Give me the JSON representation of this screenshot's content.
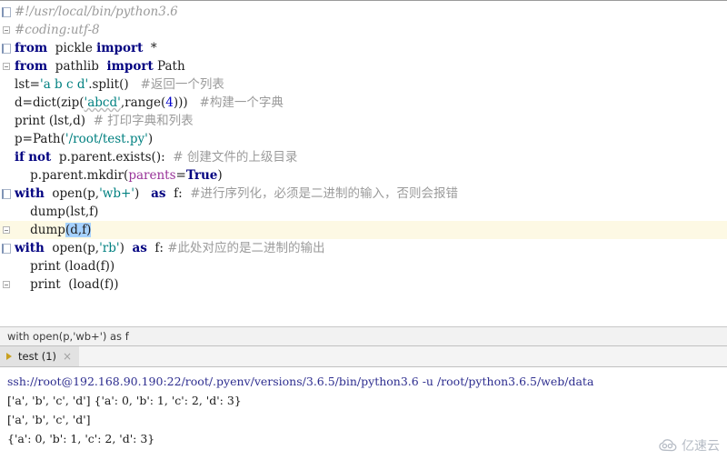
{
  "editor": {
    "lines": [
      {
        "gutter": "region",
        "highlight": false,
        "tokens": [
          {
            "t": "#!/usr/local/bin/python3.6",
            "c": "cmt-it"
          }
        ]
      },
      {
        "gutter": "collapsed",
        "highlight": false,
        "tokens": [
          {
            "t": "#coding:utf-8",
            "c": "cmt-it"
          }
        ]
      },
      {
        "gutter": "region",
        "highlight": false,
        "tokens": [
          {
            "t": "from",
            "c": "kw"
          },
          {
            "t": "  pickle ",
            "c": "plain"
          },
          {
            "t": "import",
            "c": "kw"
          },
          {
            "t": "  *",
            "c": "plain"
          }
        ]
      },
      {
        "gutter": "collapsed",
        "highlight": false,
        "tokens": [
          {
            "t": "from",
            "c": "kw"
          },
          {
            "t": "  pathlib  ",
            "c": "plain"
          },
          {
            "t": "import",
            "c": "kw"
          },
          {
            "t": " Path",
            "c": "plain"
          }
        ]
      },
      {
        "gutter": "empty",
        "highlight": false,
        "tokens": [
          {
            "t": "lst=",
            "c": "plain"
          },
          {
            "t": "'a b c d'",
            "c": "str"
          },
          {
            "t": ".split()   ",
            "c": "plain"
          },
          {
            "t": "#返回一个列表",
            "c": "cmt"
          }
        ]
      },
      {
        "gutter": "empty",
        "highlight": false,
        "tokens": [
          {
            "t": "d=dict(zip(",
            "c": "plain"
          },
          {
            "t": "'abcd'",
            "c": "str wavy"
          },
          {
            "t": ",range(",
            "c": "plain"
          },
          {
            "t": "4",
            "c": "num"
          },
          {
            "t": ")))   ",
            "c": "plain"
          },
          {
            "t": "#构建一个字典",
            "c": "cmt"
          }
        ]
      },
      {
        "gutter": "empty",
        "highlight": false,
        "tokens": [
          {
            "t": "print",
            "c": "plain"
          },
          {
            "t": " (lst,d)  ",
            "c": "plain"
          },
          {
            "t": "# 打印字典和列表",
            "c": "cmt"
          }
        ]
      },
      {
        "gutter": "empty",
        "highlight": false,
        "tokens": [
          {
            "t": "p=Path(",
            "c": "plain"
          },
          {
            "t": "'/root/test.py'",
            "c": "str"
          },
          {
            "t": ")",
            "c": "plain"
          }
        ]
      },
      {
        "gutter": "empty",
        "highlight": false,
        "tokens": [
          {
            "t": "if",
            "c": "kw"
          },
          {
            "t": " ",
            "c": "plain"
          },
          {
            "t": "not",
            "c": "kw"
          },
          {
            "t": "  p.parent.exists():  ",
            "c": "plain"
          },
          {
            "t": "# 创建文件的上级目录",
            "c": "cmt"
          }
        ]
      },
      {
        "gutter": "empty",
        "highlight": false,
        "tokens": [
          {
            "t": "    p.parent.mkdir(",
            "c": "plain"
          },
          {
            "t": "parents",
            "c": "arg"
          },
          {
            "t": "=",
            "c": "plain"
          },
          {
            "t": "True",
            "c": "kw"
          },
          {
            "t": ")",
            "c": "plain"
          }
        ]
      },
      {
        "gutter": "region",
        "highlight": false,
        "tokens": [
          {
            "t": "with",
            "c": "kw"
          },
          {
            "t": "  open(p,",
            "c": "plain"
          },
          {
            "t": "'wb+'",
            "c": "str"
          },
          {
            "t": ")   ",
            "c": "plain"
          },
          {
            "t": "as",
            "c": "kw"
          },
          {
            "t": "  f:  ",
            "c": "plain"
          },
          {
            "t": "#进行序列化，必须是二进制的输入，否则会报错",
            "c": "cmt"
          }
        ]
      },
      {
        "gutter": "empty",
        "highlight": false,
        "tokens": [
          {
            "t": "    dump(lst,f)",
            "c": "plain"
          }
        ]
      },
      {
        "gutter": "collapsed",
        "highlight": true,
        "tokens": [
          {
            "t": "    dump",
            "c": "plain"
          },
          {
            "t": "(d,f)",
            "c": "plain sel"
          }
        ]
      },
      {
        "gutter": "region",
        "highlight": false,
        "tokens": [
          {
            "t": "with",
            "c": "kw"
          },
          {
            "t": "  open(p,",
            "c": "plain"
          },
          {
            "t": "'rb'",
            "c": "str"
          },
          {
            "t": ")  ",
            "c": "plain"
          },
          {
            "t": "as",
            "c": "kw"
          },
          {
            "t": "  f: ",
            "c": "plain"
          },
          {
            "t": "#此处对应的是二进制的输出",
            "c": "cmt"
          }
        ]
      },
      {
        "gutter": "empty",
        "highlight": false,
        "tokens": [
          {
            "t": "    print (load(f))",
            "c": "plain"
          }
        ]
      },
      {
        "gutter": "collapsed",
        "highlight": false,
        "tokens": [
          {
            "t": "    print  (load(f))",
            "c": "plain"
          }
        ]
      }
    ]
  },
  "breadcrumb": {
    "text": "with open(p,'wb+') as f"
  },
  "tabbar": {
    "tabs": [
      {
        "label": "test (1)",
        "close": "×",
        "icon": "run-icon"
      }
    ]
  },
  "console": {
    "lines": [
      {
        "text": "ssh://root@192.168.90.190:22/root/.pyenv/versions/3.6.5/bin/python3.6 -u /root/python3.6.5/web/data",
        "kind": "cmd"
      },
      {
        "text": "['a', 'b', 'c', 'd'] {'a': 0, 'b': 1, 'c': 2, 'd': 3}",
        "kind": "out"
      },
      {
        "text": "['a', 'b', 'c', 'd']",
        "kind": "out"
      },
      {
        "text": "{'a': 0, 'b': 1, 'c': 2, 'd': 3}",
        "kind": "out"
      }
    ]
  },
  "watermark": {
    "text": "亿速云",
    "icon": "cloud-icon"
  },
  "colors": {
    "keyword": "#000080",
    "string": "#008080",
    "comment": "#9b9b9b",
    "number": "#0000cd",
    "named_arg": "#993399",
    "selection": "#a6d2ff",
    "line_highlight": "#fdf9e4",
    "console_command": "#2d2d8f",
    "watermark": "#9aa3b0"
  }
}
